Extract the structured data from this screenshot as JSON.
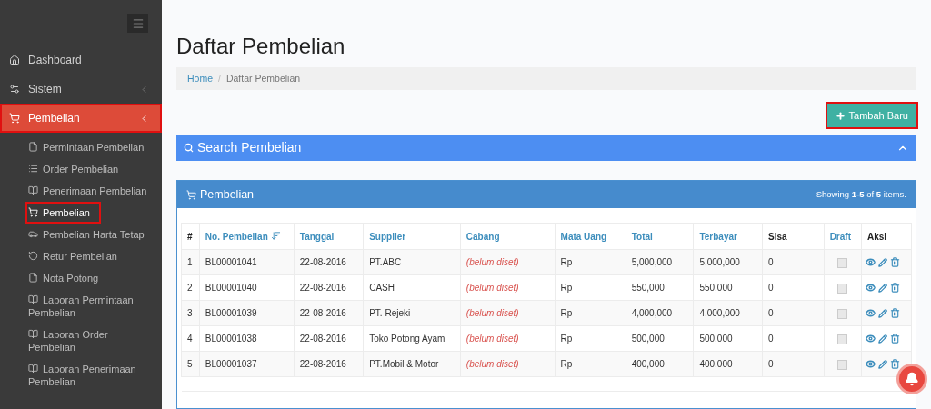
{
  "sidebar": {
    "items": [
      {
        "label": "Dashboard",
        "selected": false,
        "outlined": false
      },
      {
        "label": "Sistem",
        "selected": false,
        "outlined": false
      },
      {
        "label": "Pembelian",
        "selected": true,
        "outlined": true,
        "children": [
          {
            "label": "Permintaan Pembelian",
            "selected": false,
            "outlined": false
          },
          {
            "label": "Order Pembelian",
            "selected": false,
            "outlined": false
          },
          {
            "label": "Penerimaan Pembelian",
            "selected": false,
            "outlined": false
          },
          {
            "label": "Pembelian",
            "selected": true,
            "outlined": true
          },
          {
            "label": "Pembelian Harta Tetap",
            "selected": false,
            "outlined": false
          },
          {
            "label": "Retur Pembelian",
            "selected": false,
            "outlined": false
          },
          {
            "label": "Nota Potong",
            "selected": false,
            "outlined": false
          },
          {
            "label": "Laporan Permintaan Pembelian",
            "selected": false,
            "outlined": false
          },
          {
            "label": "Laporan Order Pembelian",
            "selected": false,
            "outlined": false
          },
          {
            "label": "Laporan Penerimaan Pembelian",
            "selected": false,
            "outlined": false
          }
        ]
      }
    ]
  },
  "page": {
    "title": "Daftar Pembelian",
    "breadcrumb": [
      "Home",
      "Daftar Pembelian"
    ],
    "breadcrumb_separator": "/"
  },
  "add_button": {
    "label": "Tambah Baru",
    "outlined": true
  },
  "search_panel": {
    "title": "Search Pembelian",
    "expanded": true
  },
  "table_panel": {
    "title": "Pembelian",
    "summary": "Showing **1-5** of **5** items.",
    "columns": [
      {
        "label": "#",
        "sortable": false,
        "sorted": false
      },
      {
        "label": "No. Pembelian",
        "sortable": true,
        "sorted": true
      },
      {
        "label": "Tanggal",
        "sortable": true,
        "sorted": false
      },
      {
        "label": "Supplier",
        "sortable": true,
        "sorted": false
      },
      {
        "label": "Cabang",
        "sortable": true,
        "sorted": false
      },
      {
        "label": "Mata Uang",
        "sortable": true,
        "sorted": false
      },
      {
        "label": "Total",
        "sortable": true,
        "sorted": false
      },
      {
        "label": "Terbayar",
        "sortable": true,
        "sorted": false
      },
      {
        "label": "Sisa",
        "sortable": false,
        "sorted": false
      },
      {
        "label": "Draft",
        "sortable": true,
        "sorted": false
      },
      {
        "label": "Aksi",
        "sortable": false,
        "sorted": false
      }
    ],
    "rows": [
      {
        "no": "1",
        "number": "BL00001041",
        "date": "22-08-2016",
        "supplier": "PT.ABC",
        "branch": "(belum diset)",
        "currency": "Rp",
        "total": "5,000,000",
        "paid": "5,000,000",
        "remaining": "0",
        "draft": false
      },
      {
        "no": "2",
        "number": "BL00001040",
        "date": "22-08-2016",
        "supplier": "CASH",
        "branch": "(belum diset)",
        "currency": "Rp",
        "total": "550,000",
        "paid": "550,000",
        "remaining": "0",
        "draft": false
      },
      {
        "no": "3",
        "number": "BL00001039",
        "date": "22-08-2016",
        "supplier": "PT. Rejeki",
        "branch": "(belum diset)",
        "currency": "Rp",
        "total": "4,000,000",
        "paid": "4,000,000",
        "remaining": "0",
        "draft": false
      },
      {
        "no": "4",
        "number": "BL00001038",
        "date": "22-08-2016",
        "supplier": "Toko Potong Ayam",
        "branch": "(belum diset)",
        "currency": "Rp",
        "total": "500,000",
        "paid": "500,000",
        "remaining": "0",
        "draft": false
      },
      {
        "no": "5",
        "number": "BL00001037",
        "date": "22-08-2016",
        "supplier": "PT.Mobil & Motor",
        "branch": "(belum diset)",
        "currency": "Rp",
        "total": "400,000",
        "paid": "400,000",
        "remaining": "0",
        "draft": false
      }
    ]
  }
}
